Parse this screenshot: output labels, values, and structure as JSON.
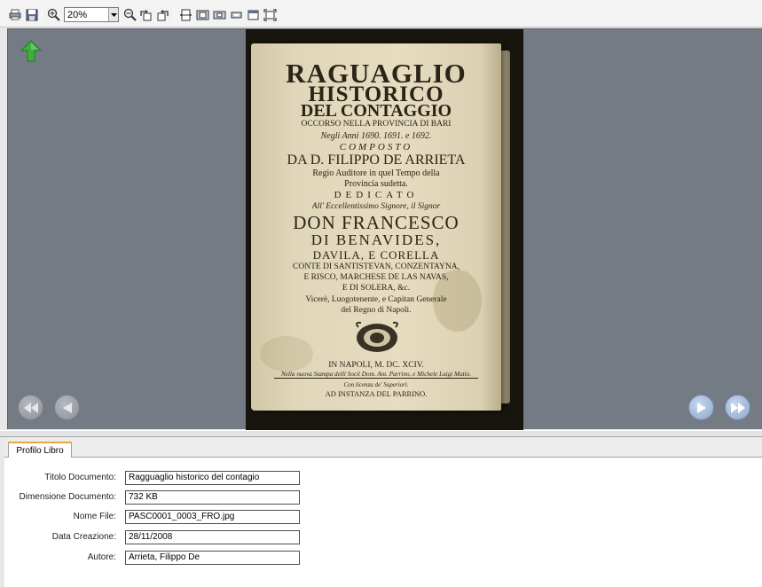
{
  "toolbar": {
    "zoom_value": "20%"
  },
  "book_page": {
    "lines": [
      "RAGUAGLIO",
      "HISTORICO",
      "DEL CONTAGGIO",
      "OCCORSO NELLA PROVINCIA DI BARI",
      "Negli Anni 1690. 1691. e 1692.",
      "COMPOSTO",
      "DA D. FILIPPO DE ARRIETA",
      "Regio Auditore in quel Tempo della",
      "Provincia sudetta.",
      "DEDICATO",
      "All' Eccellentissimo Signore, il Signor",
      "DON FRANCESCO",
      "DI BENAVIDES,",
      "DAVILA, E CORELLA",
      "CONTE DI SANTISTEVAN, CONZENTAYNA,",
      "E RISCO, MARCHESE DE LAS NAVAS,",
      "E DI SOLERA, &c.",
      "Vicerè, Luogotenente, e Capitan Generale",
      "del Regno di Napoli.",
      "IN NAPOLI, M. DC. XCIV.",
      "Nella nuova Stampa delli Socii Dom. Ant. Parrino, e Michele Luigi Mutio.",
      "Con licenza de' Superiori.",
      "AD INSTANZA DEL PARRINO."
    ]
  },
  "profile": {
    "tab_label": "Profilo Libro",
    "fields": [
      {
        "label": "Titolo Documento:",
        "value": "Ragguaglio historico del contagio"
      },
      {
        "label": "Dimensione Documento:",
        "value": "732 KB"
      },
      {
        "label": "Nome File:",
        "value": "PASC0001_0003_FRO.jpg"
      },
      {
        "label": "Data Creazione:",
        "value": "28/11/2008"
      },
      {
        "label": "Autore:",
        "value": "Arrieta, Filippo De"
      }
    ]
  },
  "icons": {
    "home": "up-arrow-icon",
    "first": "first-page-icon",
    "prev": "previous-page-icon",
    "next": "next-page-icon",
    "last": "last-page-icon"
  },
  "colors": {
    "viewer_bg": "#757b85",
    "home_arrow": "#3fae3f",
    "tab_accent": "#e8a83d"
  }
}
